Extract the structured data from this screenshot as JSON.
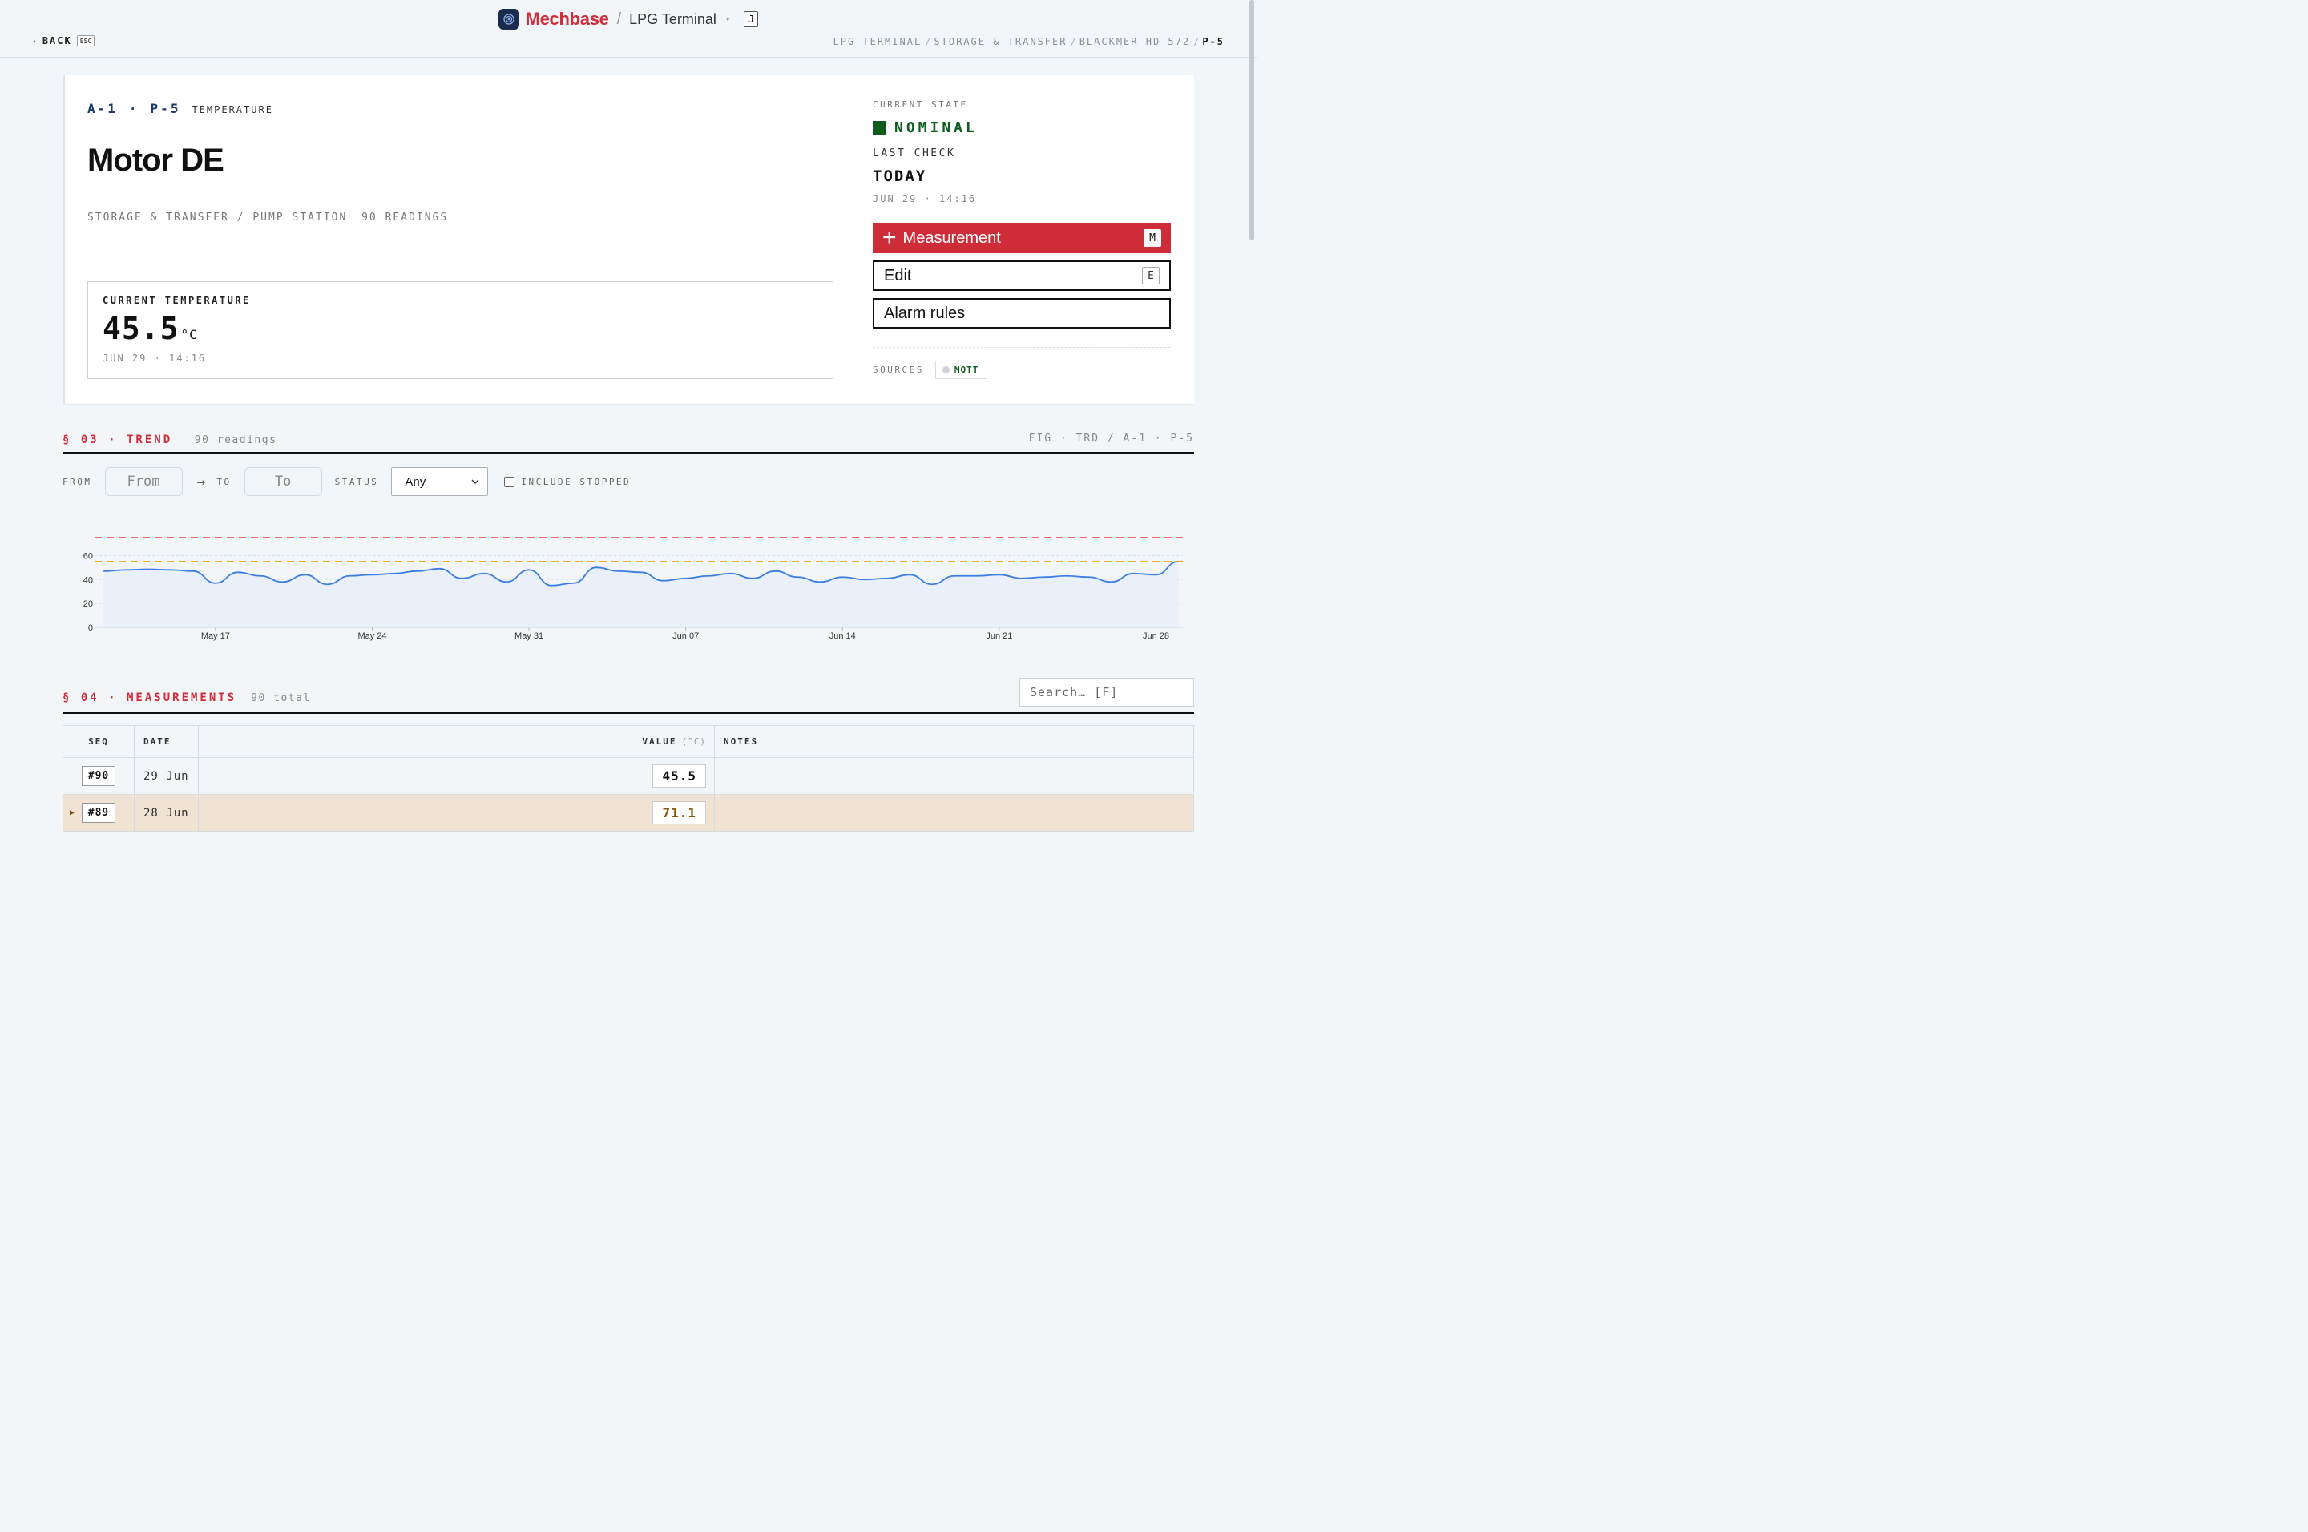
{
  "brand": {
    "name": "Mechbase",
    "separator": "/",
    "site": "LPG Terminal",
    "caret": "▾",
    "shortcut": "J"
  },
  "nav": {
    "back_arrow": "◂",
    "back_label": "BACK",
    "back_shortcut": "ESC",
    "breadcrumb": [
      "LPG TERMINAL",
      "STORAGE & TRANSFER",
      "BLACKMER HD-572",
      "P-5"
    ],
    "breadcrumb_sep": "/"
  },
  "asset": {
    "area_code": "A-1",
    "dot": "·",
    "point_code": "P-5",
    "type": "TEMPERATURE",
    "title": "Motor DE",
    "path": "STORAGE & TRANSFER / PUMP STATION",
    "readings": "90 READINGS"
  },
  "current": {
    "label": "CURRENT TEMPERATURE",
    "value": "45.5",
    "unit": "°C",
    "timestamp": "JUN 29 · 14:16"
  },
  "state": {
    "caption": "CURRENT STATE",
    "status": "NOMINAL",
    "status_color": "#0f5d1d",
    "last_check_label": "LAST CHECK",
    "last_check": "TODAY",
    "last_check_ts": "JUN 29 · 14:16"
  },
  "actions": {
    "measurement": {
      "icon": "+",
      "label": "Measurement",
      "shortcut": "M"
    },
    "edit": {
      "label": "Edit",
      "shortcut": "E"
    },
    "alarm_rules": {
      "label": "Alarm rules"
    }
  },
  "sources": {
    "label": "SOURCES",
    "items": [
      "MQTT"
    ]
  },
  "trend": {
    "section": "§ 03 · TREND",
    "meta": "90 readings",
    "figure": "FIG · TRD / A-1 · P-5",
    "filters": {
      "from_label": "FROM",
      "from_placeholder": "From",
      "arrow": "→",
      "to_label": "TO",
      "to_placeholder": "To",
      "status_label": "STATUS",
      "status_value": "Any",
      "include_stopped": "INCLUDE STOPPED"
    }
  },
  "chart_data": {
    "type": "line",
    "y_ticks": [
      0,
      20,
      40,
      60
    ],
    "ylim": [
      0,
      60
    ],
    "x_ticks": [
      "May 17",
      "May 24",
      "May 31",
      "Jun 07",
      "Jun 14",
      "Jun 21",
      "Jun 28"
    ],
    "x_tick_days": [
      17,
      24,
      31,
      38,
      45,
      52,
      59
    ],
    "x_range_days": [
      11.6,
      60.2
    ],
    "thresholds": [
      {
        "value": 55,
        "color": "#e8a317",
        "style": "dashed"
      },
      {
        "value": 75,
        "color": "#e0413f",
        "style": "dashed"
      }
    ],
    "series": [
      {
        "color": "#3b7de0",
        "x": [
          12,
          13,
          14,
          15,
          16,
          17,
          18,
          19,
          20,
          21,
          22,
          23,
          24,
          25,
          26,
          27,
          28,
          29,
          30,
          31,
          32,
          33,
          34,
          35,
          36,
          37,
          38,
          39,
          40,
          41,
          42,
          43,
          44,
          45,
          46,
          47,
          48,
          49,
          50,
          51,
          52,
          53,
          54,
          55,
          56,
          57,
          58,
          59,
          60
        ],
        "values": [
          47,
          48,
          48.5,
          48,
          47,
          37,
          46,
          43,
          38,
          44,
          36,
          43,
          44,
          45,
          47,
          49,
          41,
          45,
          38,
          48,
          35,
          37,
          50,
          47,
          46,
          39,
          41,
          43,
          45,
          41,
          47,
          42,
          38,
          42,
          40,
          41,
          44,
          36,
          43,
          43,
          44,
          41,
          42,
          43,
          42,
          38,
          45,
          44,
          55
        ]
      }
    ]
  },
  "measurements": {
    "section": "§ 04 · MEASUREMENTS",
    "meta": "90 total",
    "search_placeholder": "Search… [F]",
    "columns": {
      "seq": "SEQ",
      "date": "DATE",
      "value": "VALUE",
      "value_unit": "(°C)",
      "notes": "NOTES"
    },
    "rows": [
      {
        "seq": "#90",
        "date": "29 Jun",
        "value": "45.5",
        "notes": ""
      },
      {
        "seq": "#89",
        "date": "28 Jun",
        "value": "71.1",
        "notes": "",
        "marker": "▶"
      }
    ]
  }
}
